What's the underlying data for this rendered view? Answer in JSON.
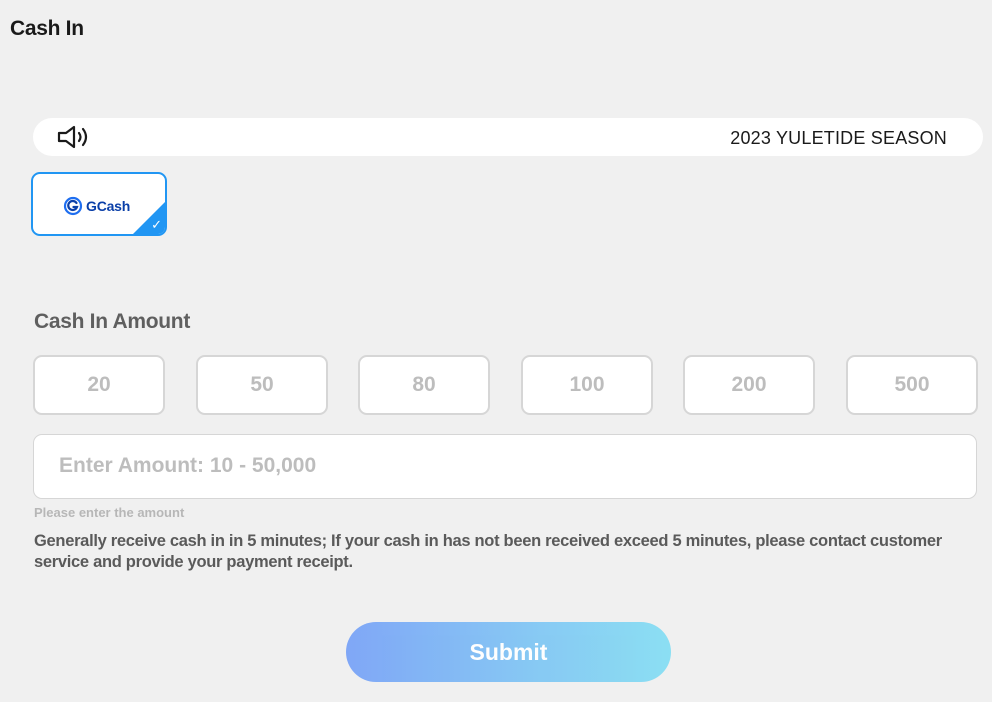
{
  "page": {
    "title": "Cash In"
  },
  "announcement": {
    "icon": "speaker-icon",
    "text": "2023 YULETIDE SEASON"
  },
  "payment_methods": [
    {
      "label": "GCash",
      "icon": "gcash-logo-icon",
      "selected": true
    }
  ],
  "amount_section": {
    "title": "Cash In Amount",
    "presets": [
      "20",
      "50",
      "80",
      "100",
      "200",
      "500"
    ],
    "input_placeholder": "Enter Amount: 10 - 50,000",
    "input_value": "",
    "hint": "Please enter the amount",
    "notice": "Generally receive cash in in 5 minutes; If your cash in has not been received exceed 5 minutes, please contact customer service and provide your payment receipt."
  },
  "submit": {
    "label": "Submit"
  },
  "colors": {
    "accent": "#2196f3",
    "gcash_brand": "#0a3fa8",
    "submit_gradient_start": "#7aa3f7",
    "submit_gradient_end": "#86def3",
    "background": "#f0f0f0"
  }
}
